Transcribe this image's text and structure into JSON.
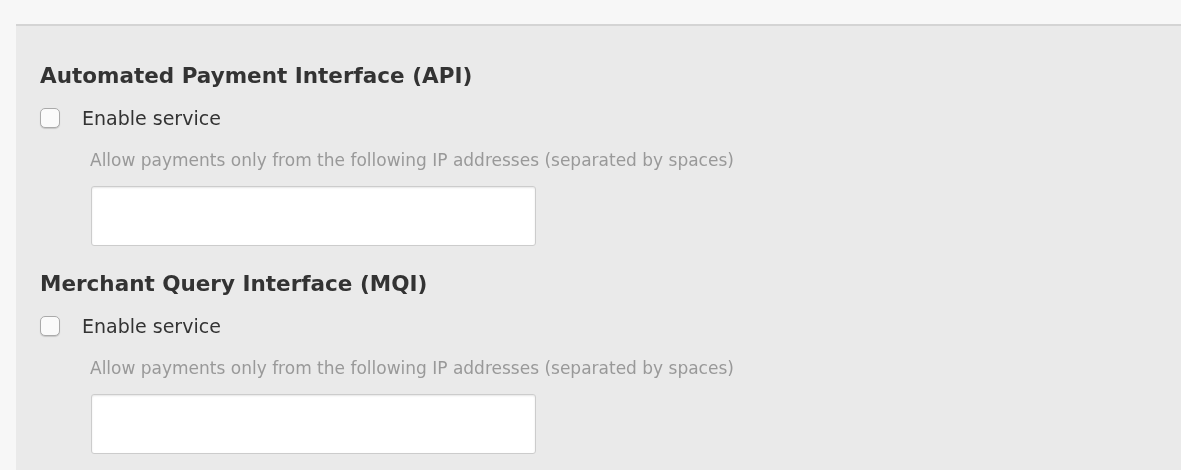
{
  "sections": [
    {
      "title": "Automated Payment Interface (API)",
      "enable": {
        "label": "Enable service",
        "checked": false
      },
      "hint": "Allow payments only from the following IP addresses (separated by spaces)"
    },
    {
      "title": "Merchant Query Interface (MQI)",
      "enable": {
        "label": "Enable service",
        "checked": false
      },
      "hint": "Allow payments only from the following IP addresses (separated by spaces)"
    }
  ]
}
